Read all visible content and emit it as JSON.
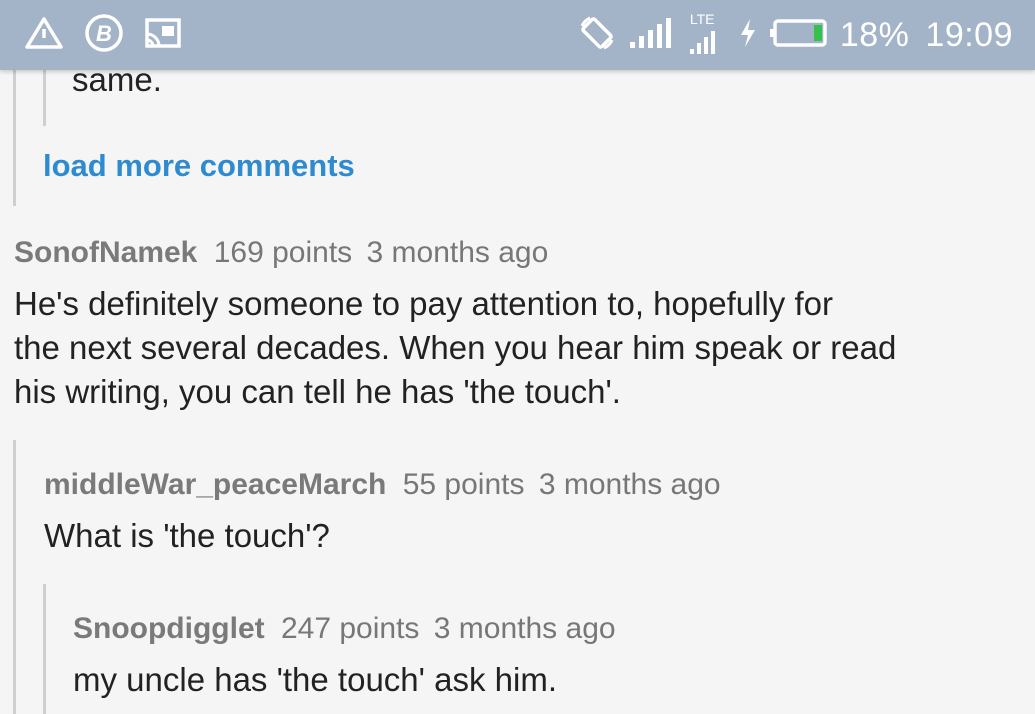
{
  "status_bar": {
    "left_icons": [
      "warning-triangle-icon",
      "bitcoin-icon",
      "cast-icon"
    ],
    "right_icons": [
      "screen-rotate-icon",
      "signal-icon",
      "lte-signal-icon",
      "charging-icon",
      "battery-icon"
    ],
    "lte_label": "LTE",
    "battery_percent": "18%",
    "time": "19:09",
    "battery_level": 0.18,
    "battery_color": "#35c24a",
    "background_color": "#a4b4c8"
  },
  "thread": {
    "truncated_text": "same.",
    "load_more_label": "load more comments",
    "link_color": "#2f8bd0",
    "comments": [
      {
        "author": "SonofNamek",
        "points": "169 points",
        "age": "3 months ago",
        "lines": [
          "He's definitely someone to pay attention to, hopefully for",
          "the next several decades. When you hear him speak or read",
          "his writing, you can tell he has 'the touch'."
        ]
      },
      {
        "author": "middleWar_peaceMarch",
        "points": "55 points",
        "age": "3 months ago",
        "lines": [
          "What is 'the touch'?"
        ]
      },
      {
        "author": "Snoopdigglet",
        "points": "247 points",
        "age": "3 months ago",
        "lines": [
          "my uncle has 'the touch' ask him."
        ]
      }
    ]
  }
}
